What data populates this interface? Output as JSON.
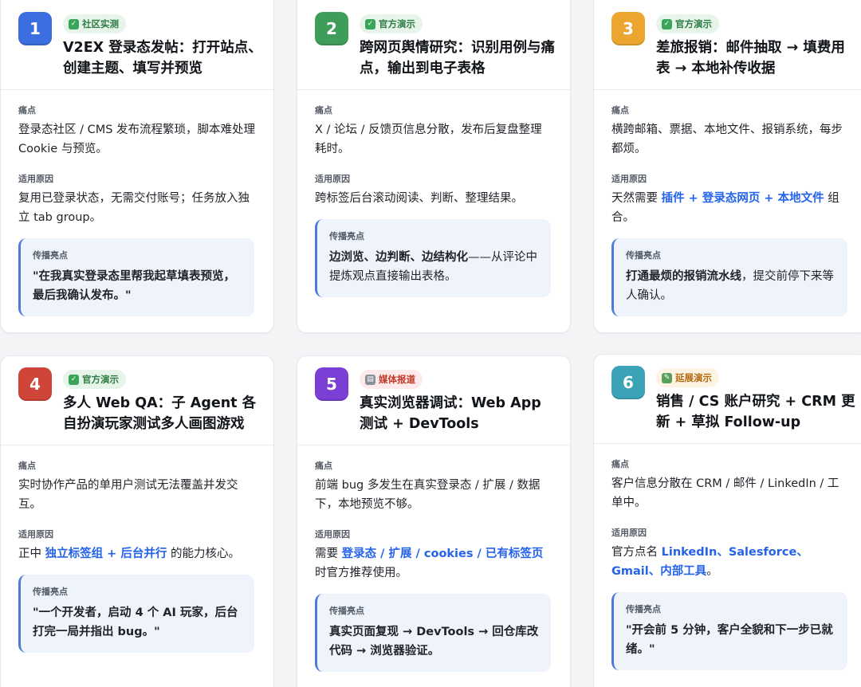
{
  "labels": {
    "pain": "痛点",
    "reason": "适用原因",
    "highlight": "传播亮点"
  },
  "cards": [
    {
      "number": "1",
      "number_color": "#3b6fe0",
      "badge": {
        "icon": "check-icon",
        "glyph": "✓",
        "text": "社区实测",
        "bg": "#e6f4ea",
        "color": "#2f7d44",
        "icon_bg": "#3aa55a"
      },
      "title": "V2EX 登录态发帖：打开站点、创建主题、填写并预览",
      "pain": "登录态社区 / CMS 发布流程繁琐，脚本难处理 Cookie 与预览。",
      "reason": {
        "before": "复用已登录状态，无需交付账号；任务放入独立 tab group。",
        "hl": "",
        "after": ""
      },
      "highlight": {
        "bold": "\"在我真实登录态里帮我起草填表预览，最后我确认发布。\"",
        "rest": ""
      }
    },
    {
      "number": "2",
      "number_color": "#3f9d5a",
      "badge": {
        "icon": "check-icon",
        "glyph": "✓",
        "text": "官方演示",
        "bg": "#e6f4ea",
        "color": "#2f7d44",
        "icon_bg": "#3aa55a"
      },
      "title": "跨网页舆情研究：识别用例与痛点，输出到电子表格",
      "pain": "X / 论坛 / 反馈页信息分散，发布后复盘整理耗时。",
      "reason": {
        "before": "跨标签后台滚动阅读、判断、整理结果。",
        "hl": "",
        "after": ""
      },
      "highlight": {
        "bold": "边浏览、边判断、边结构化",
        "rest": "——从评论中提炼观点直接输出表格。"
      }
    },
    {
      "number": "3",
      "number_color": "#eca62f",
      "badge": {
        "icon": "check-icon",
        "glyph": "✓",
        "text": "官方演示",
        "bg": "#e6f4ea",
        "color": "#2f7d44",
        "icon_bg": "#3aa55a"
      },
      "title": "差旅报销：邮件抽取 → 填费用表 → 本地补传收据",
      "pain": "横跨邮箱、票据、本地文件、报销系统，每步都烦。",
      "reason": {
        "before": "天然需要 ",
        "hl": "插件 + 登录态网页 + 本地文件",
        "after": " 组合。"
      },
      "highlight": {
        "bold": "打通最烦的报销流水线",
        "rest": "，提交前停下来等人确认。"
      }
    },
    {
      "number": "4",
      "number_color": "#d0453a",
      "badge": {
        "icon": "check-icon",
        "glyph": "✓",
        "text": "官方演示",
        "bg": "#e6f4ea",
        "color": "#2f7d44",
        "icon_bg": "#3aa55a"
      },
      "title": "多人 Web QA：子 Agent 各自扮演玩家测试多人画图游戏",
      "pain": "实时协作产品的单用户测试无法覆盖并发交互。",
      "reason": {
        "before": "正中 ",
        "hl": "独立标签组 + 后台并行",
        "after": " 的能力核心。"
      },
      "highlight": {
        "bold": "\"一个开发者，启动 4 个 AI 玩家，后台打完一局并指出 bug。\"",
        "rest": ""
      }
    },
    {
      "number": "5",
      "number_color": "#7b3fd6",
      "badge": {
        "icon": "newspaper-icon",
        "glyph": "▤",
        "text": "媒体报道",
        "bg": "#fdeaea",
        "color": "#c0392b",
        "icon_bg": "#8a8f98"
      },
      "title": "真实浏览器调试：Web App 测试 + DevTools",
      "pain": "前端 bug 多发生在真实登录态 / 扩展 / 数据下，本地预览不够。",
      "reason": {
        "before": "需要 ",
        "hl": "登录态 / 扩展 / cookies / 已有标签页",
        "after": " 时官方推荐使用。"
      },
      "highlight": {
        "bold": "真实页面复现 → DevTools → 回仓库改代码 → 浏览器验证。",
        "rest": ""
      }
    },
    {
      "number": "6",
      "number_color": "#3ba3b8",
      "badge": {
        "icon": "pencil-icon",
        "glyph": "✎",
        "text": "延展演示",
        "bg": "#fdf3e2",
        "color": "#b26a12",
        "icon_bg": "#5aa05a"
      },
      "title": "销售 / CS 账户研究 + CRM 更新 + 草拟 Follow-up",
      "pain": "客户信息分散在 CRM / 邮件 / LinkedIn / 工单中。",
      "reason": {
        "before": "官方点名 ",
        "hl": "LinkedIn、Salesforce、Gmail、内部工具",
        "after": "。"
      },
      "highlight": {
        "bold": "\"开会前 5 分钟，客户全貌和下一步已就绪。\"",
        "rest": ""
      }
    }
  ]
}
